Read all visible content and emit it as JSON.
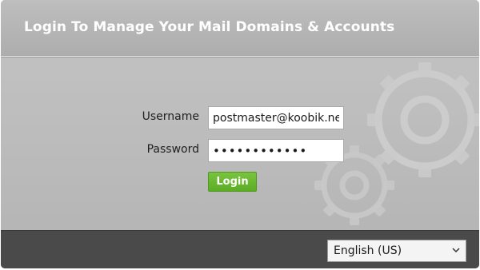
{
  "header": {
    "title": "Login To Manage Your Mail Domains & Accounts"
  },
  "form": {
    "username_label": "Username",
    "username_value": "postmaster@koobik.net",
    "password_label": "Password",
    "password_value": "••••••••••••",
    "login_label": "Login"
  },
  "footer": {
    "language_value": "English (US)"
  },
  "colors": {
    "accent": "#66b32e",
    "footer": "#4a4a4a",
    "panel": "#bdbdbd"
  },
  "icons": {
    "background": "gears-icon",
    "dropdown": "chevron-down-icon"
  }
}
